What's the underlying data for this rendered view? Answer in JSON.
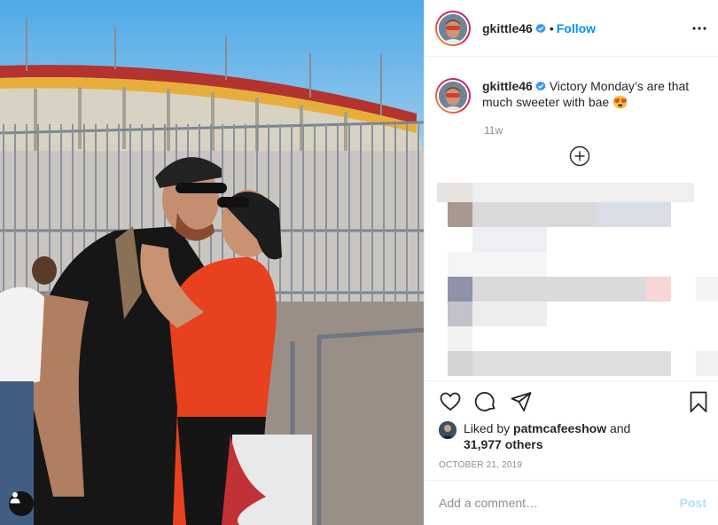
{
  "post": {
    "username": "gkittle46",
    "follow_label": "Follow",
    "dot_separator": "•",
    "more_icon": "more-horizontal-icon",
    "verified_icon": "verified-badge-icon"
  },
  "caption": {
    "username": "gkittle46",
    "text": "Victory Monday’s are that much sweeter with bae 😍",
    "time": "11w",
    "load_more_icon": "plus-circle-icon"
  },
  "actions": {
    "icons": [
      "heart-icon",
      "comment-icon",
      "share-icon",
      "bookmark-icon"
    ],
    "liked_by_prefix": "Liked by",
    "liked_by_user": "patmcafeeshow",
    "liked_by_and": "and",
    "others_count": "31,977 others",
    "date": "OCTOBER 21, 2019"
  },
  "comment_box": {
    "placeholder": "Add a comment…",
    "post_label": "Post"
  },
  "colors": {
    "accent": "#0095f6",
    "post_disabled": "#b2dffc",
    "verified": "#3897f0",
    "muted": "#8e8e8e"
  }
}
